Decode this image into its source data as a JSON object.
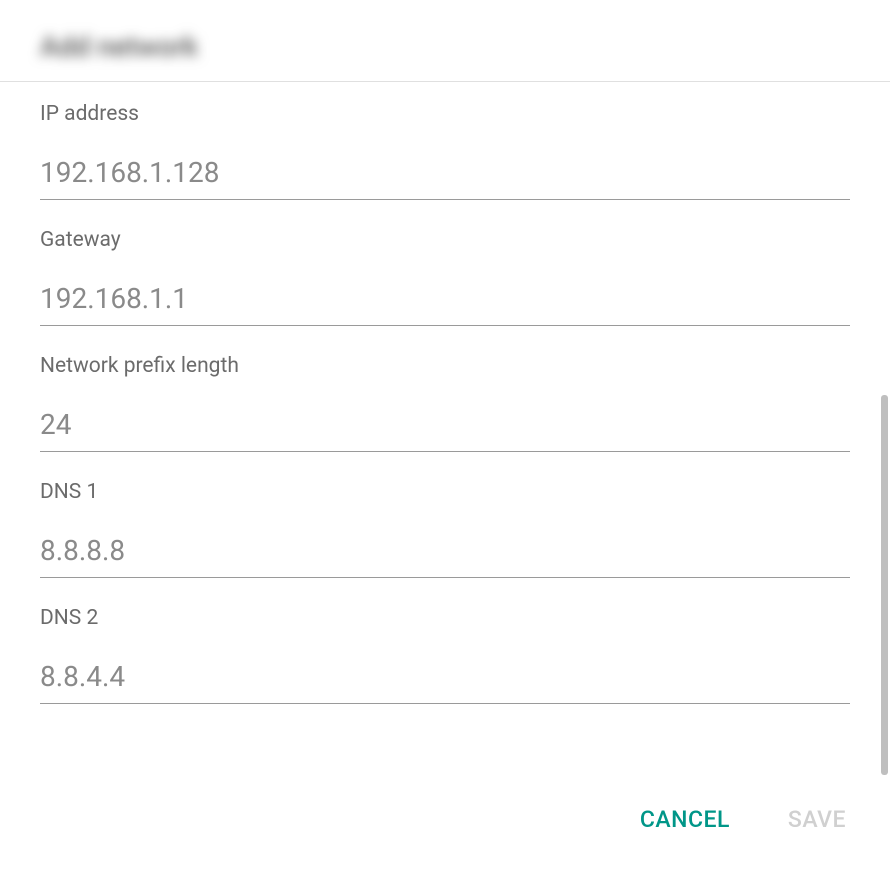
{
  "dialog": {
    "title": "Add network"
  },
  "fields": {
    "ip_address": {
      "label": "IP address",
      "placeholder": "192.168.1.128",
      "value": ""
    },
    "gateway": {
      "label": "Gateway",
      "placeholder": "192.168.1.1",
      "value": ""
    },
    "network_prefix": {
      "label": "Network prefix length",
      "placeholder": "24",
      "value": ""
    },
    "dns1": {
      "label": "DNS 1",
      "placeholder": "8.8.8.8",
      "value": ""
    },
    "dns2": {
      "label": "DNS 2",
      "placeholder": "8.8.4.4",
      "value": ""
    }
  },
  "buttons": {
    "cancel": "CANCEL",
    "save": "SAVE"
  },
  "colors": {
    "accent": "#009688",
    "disabled": "#d0d0d0"
  }
}
